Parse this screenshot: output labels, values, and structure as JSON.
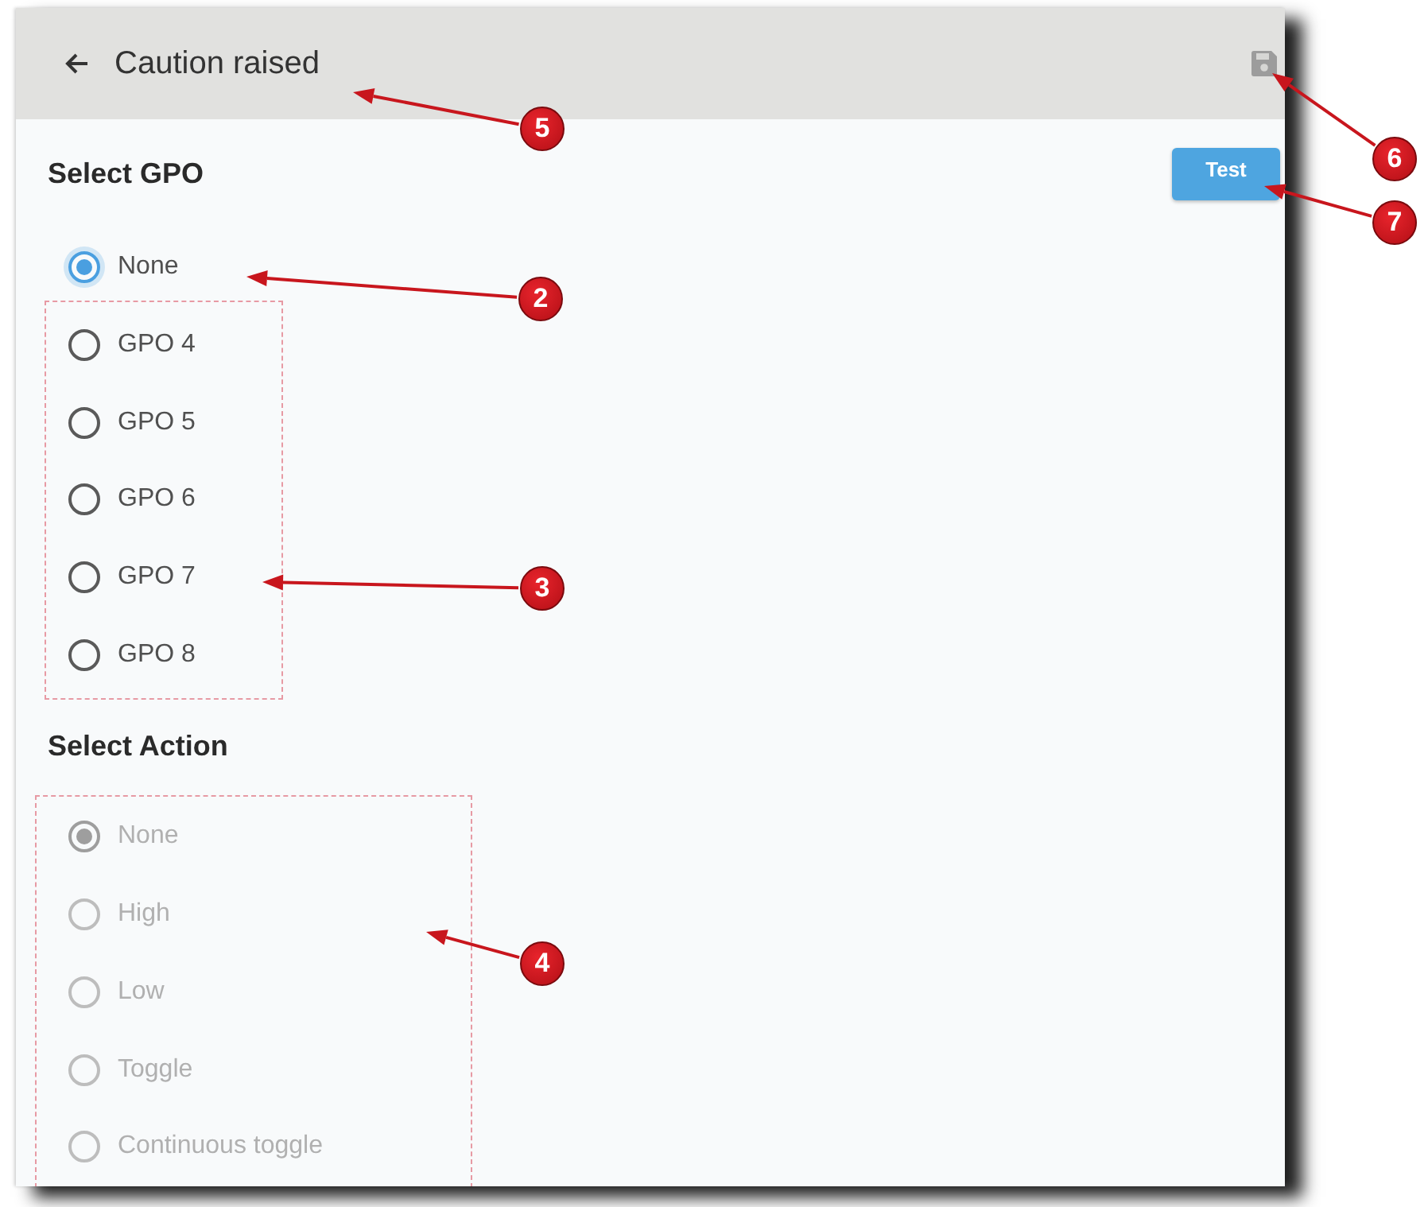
{
  "header": {
    "title": "Caution raised"
  },
  "sections": [
    {
      "heading": "Select GPO",
      "button": "Test",
      "options": [
        {
          "label": "None",
          "selected": true,
          "disabled": false,
          "highlighted": false
        },
        {
          "label": "GPO 4",
          "selected": false,
          "disabled": false,
          "highlighted": true
        },
        {
          "label": "GPO 5",
          "selected": false,
          "disabled": false,
          "highlighted": true
        },
        {
          "label": "GPO 6",
          "selected": false,
          "disabled": false,
          "highlighted": true
        },
        {
          "label": "GPO 7",
          "selected": false,
          "disabled": false,
          "highlighted": true
        },
        {
          "label": "GPO 8",
          "selected": false,
          "disabled": false,
          "highlighted": true
        }
      ]
    },
    {
      "heading": "Select Action",
      "options": [
        {
          "label": "None",
          "selected": true,
          "disabled": true,
          "highlighted": true
        },
        {
          "label": "High",
          "selected": false,
          "disabled": true,
          "highlighted": true
        },
        {
          "label": "Low",
          "selected": false,
          "disabled": true,
          "highlighted": true
        },
        {
          "label": "Toggle",
          "selected": false,
          "disabled": true,
          "highlighted": true
        },
        {
          "label": "Continuous toggle",
          "selected": false,
          "disabled": true,
          "highlighted": true
        }
      ]
    }
  ],
  "callouts": [
    {
      "number": "5"
    },
    {
      "number": "6"
    },
    {
      "number": "7"
    },
    {
      "number": "2"
    },
    {
      "number": "3"
    },
    {
      "number": "4"
    }
  ]
}
